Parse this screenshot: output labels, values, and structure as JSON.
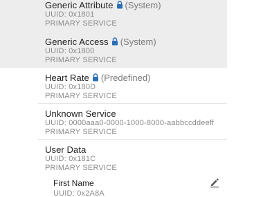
{
  "services": [
    {
      "name": "Generic Attribute",
      "locked": true,
      "tag": "(System)",
      "uuid": "UUID: 0x1801",
      "kind": "PRIMARY SERVICE"
    },
    {
      "name": "Generic Access",
      "locked": true,
      "tag": "(System)",
      "uuid": "UUID: 0x1800",
      "kind": "PRIMARY SERVICE"
    },
    {
      "name": "Heart Rate",
      "locked": true,
      "tag": "(Predefined)",
      "uuid": "UUID: 0x180D",
      "kind": "PRIMARY SERVICE"
    },
    {
      "name": "Unknown Service",
      "locked": false,
      "tag": "",
      "uuid": "UUID: 0000aaa0-0000-1000-8000-aabbccddeeff",
      "kind": "PRIMARY SERVICE"
    },
    {
      "name": "User Data",
      "locked": false,
      "tag": "",
      "uuid": "UUID: 0x181C",
      "kind": "PRIMARY SERVICE"
    }
  ],
  "characteristic": {
    "name": "First Name",
    "uuid": "UUID: 0x2A8A"
  },
  "icons": {
    "lock": "lock-icon",
    "edit": "pencil-edit-icon"
  },
  "colors": {
    "system_row_bg": "#ededed",
    "lock_blue": "#2a6fb5",
    "edit_gray": "#555555"
  }
}
